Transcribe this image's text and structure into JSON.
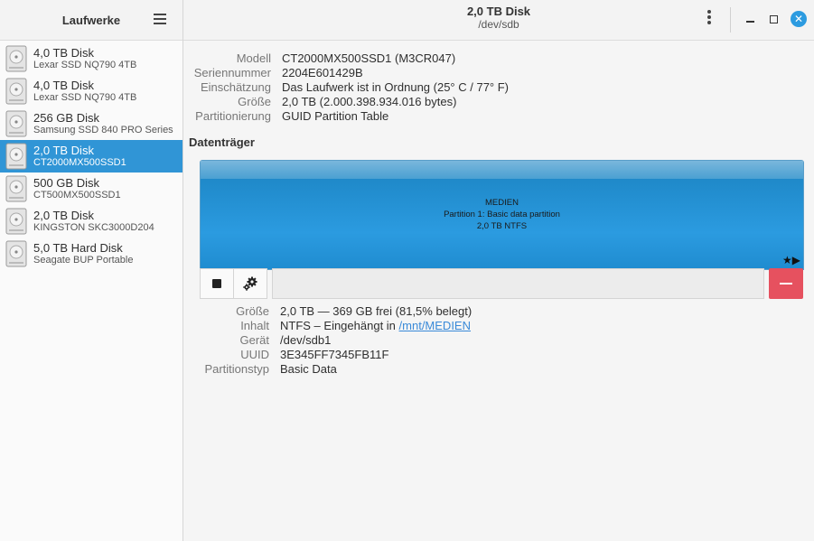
{
  "sidebar": {
    "title": "Laufwerke",
    "drives": [
      {
        "name": "4,0 TB Disk",
        "model": "Lexar SSD NQ790 4TB"
      },
      {
        "name": "4,0 TB Disk",
        "model": "Lexar SSD NQ790 4TB"
      },
      {
        "name": "256 GB Disk",
        "model": "Samsung SSD 840 PRO Series"
      },
      {
        "name": "2,0 TB Disk",
        "model": "CT2000MX500SSD1"
      },
      {
        "name": "500 GB Disk",
        "model": "CT500MX500SSD1"
      },
      {
        "name": "2,0 TB Disk",
        "model": "KINGSTON SKC3000D204"
      },
      {
        "name": "5,0 TB Hard Disk",
        "model": "Seagate BUP Portable"
      }
    ]
  },
  "header": {
    "title": "2,0 TB Disk",
    "subtitle": "/dev/sdb",
    "close_glyph": "✕"
  },
  "drive_info": {
    "model_label": "Modell",
    "model": "CT2000MX500SSD1 (M3CR047)",
    "serial_label": "Seriennummer",
    "serial": "2204E601429B",
    "assessment_label": "Einschätzung",
    "assessment": "Das Laufwerk ist in Ordnung (25° C / 77° F)",
    "size_label": "Größe",
    "size": "2,0 TB (2.000.398.934.016 bytes)",
    "partitioning_label": "Partitionierung",
    "partitioning": "GUID Partition Table"
  },
  "volumes": {
    "section_title": "Datenträger",
    "label": "MEDIEN",
    "partition": "Partition 1: Basic data partition",
    "fs": "2,0 TB NTFS",
    "markers": "★▶"
  },
  "partition_info": {
    "size_label": "Größe",
    "size": "2,0 TB — 369 GB frei (81,5% belegt)",
    "contents_label": "Inhalt",
    "contents_prefix": "NTFS – Eingehängt in",
    "mount_link": "/mnt/MEDIEN",
    "device_label": "Gerät",
    "device": "/dev/sdb1",
    "uuid_label": "UUID",
    "uuid": "3E345FF7345FB11F",
    "type_label": "Partitionstyp",
    "type": "Basic Data"
  },
  "colors": {
    "accent": "#3095d6",
    "volume": "#2b9be0",
    "delete": "#e6515f"
  },
  "selected_index": 3
}
